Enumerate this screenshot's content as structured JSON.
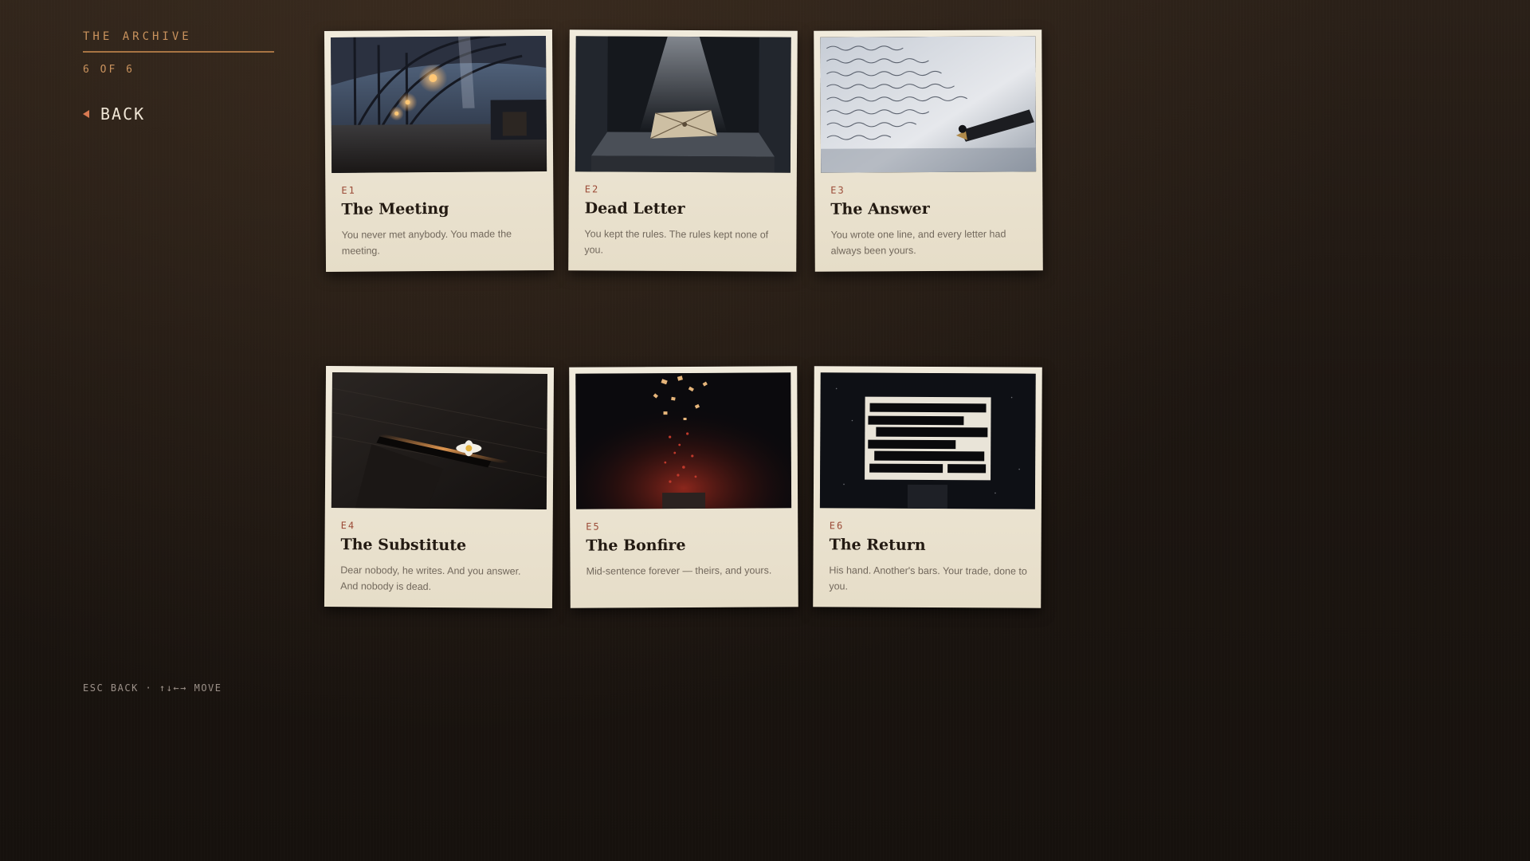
{
  "sidebar": {
    "title": "THE ARCHIVE",
    "count": "6 OF 6",
    "back_label": "BACK"
  },
  "controls_hint": "ESC BACK · ↑↓←→ MOVE",
  "cards": [
    {
      "code": "E1",
      "title": "The Meeting",
      "desc": "You never met anybody. You made the meeting.",
      "image": "train-station-illustration"
    },
    {
      "code": "E2",
      "title": "Dead Letter",
      "desc": "You kept the rules. The rules kept none of you.",
      "image": "bundled-letter-illustration"
    },
    {
      "code": "E3",
      "title": "The Answer",
      "desc": "You wrote one line, and every letter had always been yours.",
      "image": "handwritten-letter-pen-illustration"
    },
    {
      "code": "E4",
      "title": "The Substitute",
      "desc": "Dear nobody, he writes. And you answer. And nobody is dead.",
      "image": "daisy-in-drawer-illustration"
    },
    {
      "code": "E5",
      "title": "The Bonfire",
      "desc": "Mid-sentence forever — theirs, and yours.",
      "image": "burning-papers-illustration"
    },
    {
      "code": "E6",
      "title": "The Return",
      "desc": "His hand. Another's bars. Your trade, done to you.",
      "image": "redacted-letter-illustration"
    }
  ],
  "colors": {
    "accent": "#c9925d",
    "back_arrow": "#d97a52",
    "card_bg": "#ece5d4",
    "episode_code": "#9b4a36",
    "background": "#1c1510"
  }
}
